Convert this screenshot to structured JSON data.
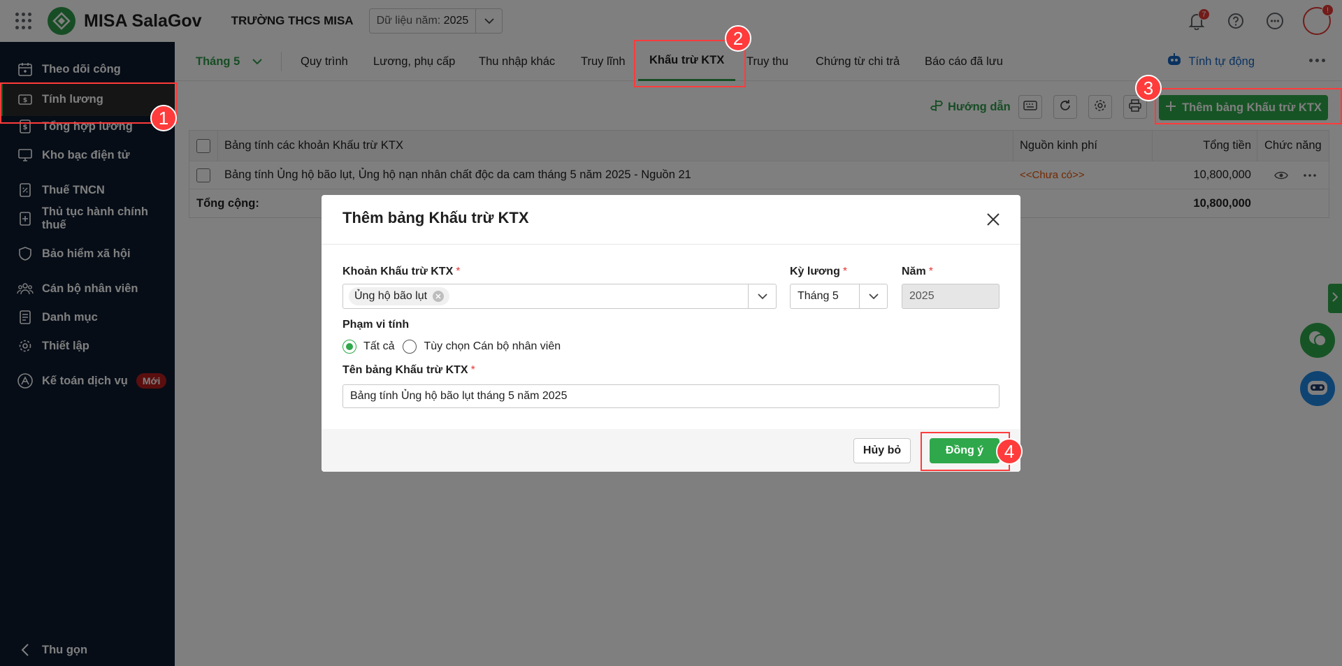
{
  "topbar": {
    "app_name": "MISA SalaGov",
    "school": "TRƯỜNG THCS MISA",
    "year_label": "Dữ liệu năm:",
    "year_value": "2025",
    "notification_count": "7",
    "avatar_badge": "!"
  },
  "sidebar": {
    "items": [
      {
        "label": "Theo dõi công",
        "icon": "calendar-icon"
      },
      {
        "label": "Tính lương",
        "icon": "wallet-icon"
      },
      {
        "label": "Tổng hợp lương",
        "icon": "money-doc-icon"
      },
      {
        "label": "Kho bạc điện tử",
        "icon": "monitor-icon"
      },
      {
        "label": "Thuế TNCN",
        "icon": "tax-doc-icon"
      },
      {
        "label": "Thủ tục hành chính thuế",
        "icon": "doc-plus-icon"
      },
      {
        "label": "Bảo hiểm xã hội",
        "icon": "shield-icon"
      },
      {
        "label": "Cán bộ nhân viên",
        "icon": "people-icon"
      },
      {
        "label": "Danh mục",
        "icon": "list-doc-icon"
      },
      {
        "label": "Thiết lập",
        "icon": "gear-icon"
      },
      {
        "label": "Kế toán dịch vụ",
        "icon": "accounting-icon"
      }
    ],
    "new_badge": "Mới",
    "collapse_label": "Thu gọn"
  },
  "tabs": {
    "month": "Tháng 5",
    "items": [
      "Quy trình",
      "Lương, phụ cấp",
      "Thu nhập khác",
      "Truy lĩnh",
      "Khấu trừ KTX",
      "Truy thu",
      "Chứng từ chi trả",
      "Báo cáo đã lưu"
    ],
    "active": "Khấu trừ KTX",
    "auto_calc": "Tính tự động"
  },
  "toolbar": {
    "guide": "Hướng dẫn",
    "add_button": "Thêm bảng Khấu trừ KTX"
  },
  "table": {
    "headers": {
      "name": "Bảng tính các khoản Khấu trừ KTX",
      "source": "Nguồn kinh phí",
      "total": "Tổng tiền",
      "actions": "Chức năng"
    },
    "rows": [
      {
        "name": "Bảng tính Ủng hộ bão lụt, Ủng hộ nạn nhân chất độc da cam tháng 5 năm 2025 - Nguồn 21",
        "source": "<<Chưa có>>",
        "total": "10,800,000"
      }
    ],
    "footer": {
      "label": "Tổng cộng:",
      "total": "10,800,000"
    }
  },
  "modal": {
    "title": "Thêm bảng Khấu trừ KTX",
    "deduction_label": "Khoản Khấu trừ KTX",
    "deduction_value": "Ủng hộ bão lụt",
    "period_label": "Kỳ lương",
    "period_value": "Tháng 5",
    "year_label": "Năm",
    "year_value": "2025",
    "scope_label": "Phạm vi tính",
    "scope_all": "Tất cả",
    "scope_custom": "Tùy chọn Cán bộ nhân viên",
    "name_label": "Tên bảng Khấu trừ KTX",
    "name_value": "Bảng tính Ủng hộ bão lụt tháng 5 năm 2025",
    "required_mark": "*",
    "cancel": "Hủy bỏ",
    "ok": "Đồng ý"
  },
  "annotations": [
    "1",
    "2",
    "3",
    "4"
  ],
  "colors": {
    "primary": "#2ea84a",
    "sidebar_bg": "#0d1b2e",
    "annotation": "#ff3b3b",
    "link_blue": "#1565c0",
    "warning_text": "#e65100"
  }
}
